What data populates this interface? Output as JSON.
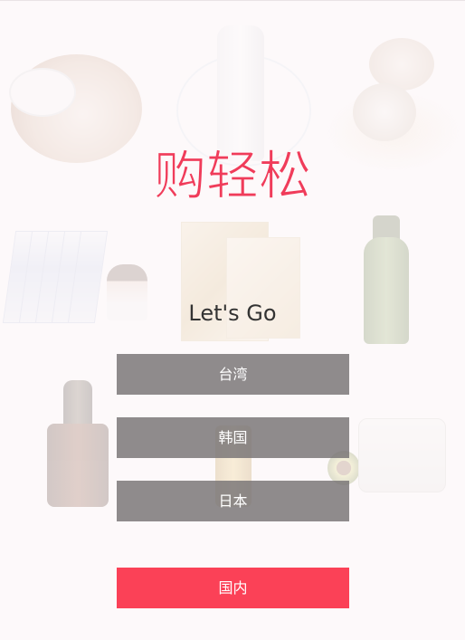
{
  "app": {
    "logo_text": "购轻松",
    "tagline": "Let's Go"
  },
  "regions": [
    {
      "label": "台湾"
    },
    {
      "label": "韩国"
    },
    {
      "label": "日本"
    }
  ],
  "domestic": {
    "label": "国内"
  },
  "colors": {
    "accent": "#fb4157",
    "logo": "#f03c5a",
    "button_gray": "#8a8788",
    "background": "#fdf9fa"
  },
  "background_products": [
    "compact-powder",
    "avene-thermal-spray",
    "cushion-compact",
    "sheet-masks",
    "gold-mask-sachet",
    "green-serum-bottle",
    "brown-night-serum",
    "yellow-oil-bottle",
    "cream-jar"
  ]
}
